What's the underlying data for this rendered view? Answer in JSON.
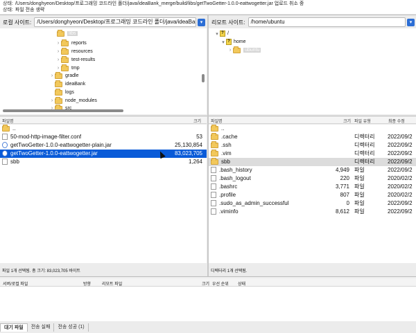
{
  "log": {
    "line1": {
      "label": "상태:",
      "text": "/Users/donghyeon/Desktop/프로그래밍 코드라인 폴더/java/ideaBank_merge/build/libs/getTwoGetter-1.0.0-eattwogetter.jar 업로드 취소 중"
    },
    "line2": {
      "label": "상태:",
      "text": "파일 전송 생략"
    }
  },
  "local": {
    "label": "로컬 사이트:",
    "path": "/Users/donghyeon/Desktop/프로그래밍 코드라인 폴더/java/ideaBank",
    "tree": [
      {
        "name": "libs",
        "selected": true
      },
      {
        "name": "reports"
      },
      {
        "name": "resources"
      },
      {
        "name": "test-results"
      },
      {
        "name": "tmp"
      },
      {
        "name": "gradle"
      },
      {
        "name": "ideaBank"
      },
      {
        "name": "logs"
      },
      {
        "name": "node_modules"
      },
      {
        "name": "src"
      }
    ],
    "columns": {
      "name": "파일명",
      "size": "크기"
    },
    "files": [
      {
        "name": "..",
        "size": "",
        "type": "folder"
      },
      {
        "name": "50-mod-http-image-filter.conf",
        "size": "53",
        "type": "file"
      },
      {
        "name": "getTwoGetter-1.0.0-eattwogetter-plain.jar",
        "size": "25,130,854",
        "type": "jar"
      },
      {
        "name": "getTwoGetter-1.0.0-eattwogetter.jar",
        "size": "83,023,705",
        "type": "jar",
        "selected": true
      },
      {
        "name": "sbb",
        "size": "1,264",
        "type": "file"
      }
    ],
    "status": "파일 1개 선택됨. 총 크기: 83,023,705 바이트"
  },
  "remote": {
    "label": "리모트 사이트:",
    "path": "/home/ubuntu",
    "tree": [
      {
        "name": "/",
        "icon": "question"
      },
      {
        "name": "home",
        "icon": "question"
      },
      {
        "name": "ubuntu",
        "icon": "folder",
        "selected": true
      }
    ],
    "columns": {
      "name": "파일명",
      "size": "크기",
      "type": "파일 유형",
      "modified": "최종 수정"
    },
    "files": [
      {
        "name": "..",
        "size": "",
        "type": "",
        "modified": "",
        "icon": "folder"
      },
      {
        "name": ".cache",
        "size": "",
        "type": "디렉터리",
        "modified": "2022/09/2",
        "icon": "folder"
      },
      {
        "name": ".ssh",
        "size": "",
        "type": "디렉터리",
        "modified": "2022/09/2",
        "icon": "folder"
      },
      {
        "name": ".vim",
        "size": "",
        "type": "디렉터리",
        "modified": "2022/09/2",
        "icon": "folder"
      },
      {
        "name": "sbb",
        "size": "",
        "type": "디렉터리",
        "modified": "2022/09/2",
        "icon": "folder",
        "selected": true
      },
      {
        "name": ".bash_history",
        "size": "4,949",
        "type": "파일",
        "modified": "2022/09/2",
        "icon": "file"
      },
      {
        "name": ".bash_logout",
        "size": "220",
        "type": "파일",
        "modified": "2020/02/2",
        "icon": "file"
      },
      {
        "name": ".bashrc",
        "size": "3,771",
        "type": "파일",
        "modified": "2020/02/2",
        "icon": "file"
      },
      {
        "name": ".profile",
        "size": "807",
        "type": "파일",
        "modified": "2020/02/2",
        "icon": "file"
      },
      {
        "name": ".sudo_as_admin_successful",
        "size": "0",
        "type": "파일",
        "modified": "2022/09/2",
        "icon": "file"
      },
      {
        "name": ".viminfo",
        "size": "8,612",
        "type": "파일",
        "modified": "2022/09/2",
        "icon": "file"
      }
    ],
    "status": "디렉터리 1개 선택됨."
  },
  "queue": {
    "columns": {
      "server_local": "서버/로컬 파일",
      "direction": "방향",
      "remote_file": "리모트 파일",
      "size": "크기",
      "priority": "우선 순위",
      "status": "상태"
    }
  },
  "tabs": [
    {
      "label": "대기 파일",
      "active": true
    },
    {
      "label": "전송 실패"
    },
    {
      "label": "전송 성공 (1)"
    }
  ]
}
